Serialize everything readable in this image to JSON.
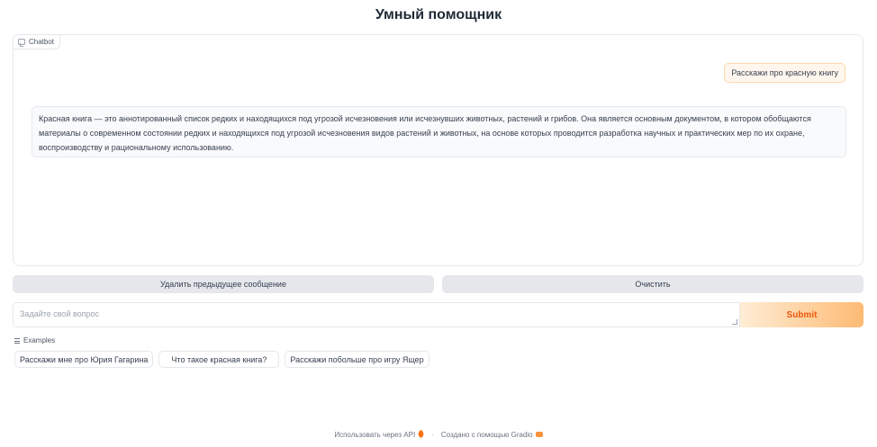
{
  "header": {
    "title": "Умный помощник"
  },
  "chatbot": {
    "label": "Chatbot",
    "messages": [
      {
        "role": "user",
        "text": "Расскажи про красную книгу"
      },
      {
        "role": "assistant",
        "text": "Красная книга — это аннотированный список редких и находящихся под угрозой исчезновения или исчезнувших животных, растений и грибов. Она является основным документом, в котором обобщаются материалы о современном состоянии редких и находящихся под угрозой исчезновения видов растений и животных, на основе которых проводится разработка научных и практических мер по их охране, воспроизводству и рациональному использованию."
      }
    ]
  },
  "actions": {
    "undo_label": "Удалить предыдущее сообщение",
    "clear_label": "Очистить"
  },
  "input": {
    "placeholder": "Задайте свой вопрос",
    "value": "",
    "submit_label": "Submit"
  },
  "examples": {
    "label": "Examples",
    "items": [
      "Расскажи мне про Юрия Гагарина",
      "Что такое красная книга?",
      "Расскажи побольше про игру Ящер"
    ]
  },
  "footer": {
    "api_label": "Использовать через API",
    "separator": "·",
    "built_with": "Создано с помощью Gradio"
  },
  "colors": {
    "accent": "#ea580c",
    "submit_gradient_start": "#ffedd5",
    "submit_gradient_end": "#fdba74",
    "user_bubble": "#fff7ed",
    "bot_bubble": "#f9fafb"
  },
  "icons": {
    "chatbot": "chat-icon",
    "examples": "list-icon",
    "api": "rocket-icon",
    "gradio": "gradio-logo-icon"
  }
}
